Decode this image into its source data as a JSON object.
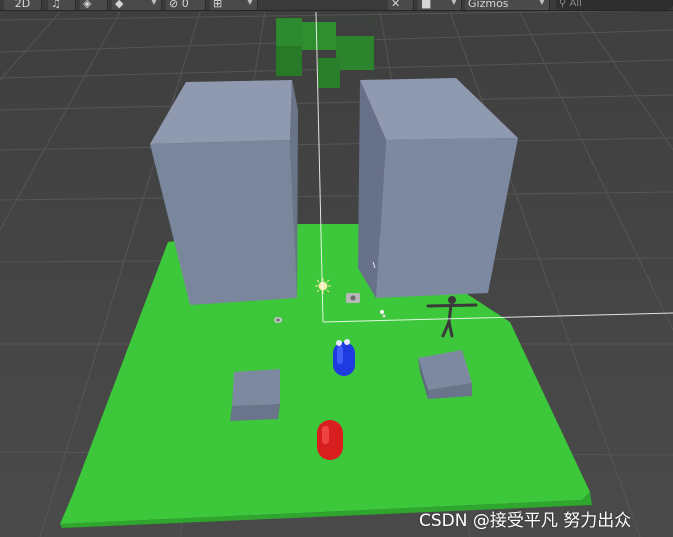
{
  "toolbar": {
    "mode_2d": "2D",
    "audio_icon": "audio-icon",
    "effects_icon": "effects-icon",
    "layers_icon": "layers-icon",
    "hidden_count": "0",
    "hidden_icon": "eye-slash-icon",
    "grid_icon": "grid-snap-icon",
    "tools_icon": "tools-icon",
    "camera_icon": "camera-icon",
    "gizmos_label": "Gizmos",
    "search_placeholder": "All"
  },
  "watermark": "CSDN @接受平凡 努力出众",
  "colors": {
    "background": "#454545",
    "ground": "#3cc83a",
    "wall_gray": "#7e8aa0",
    "blue_capsule": "#1e3be0",
    "red_capsule": "#d81e1e",
    "green_cross": "#2f8a2f"
  }
}
